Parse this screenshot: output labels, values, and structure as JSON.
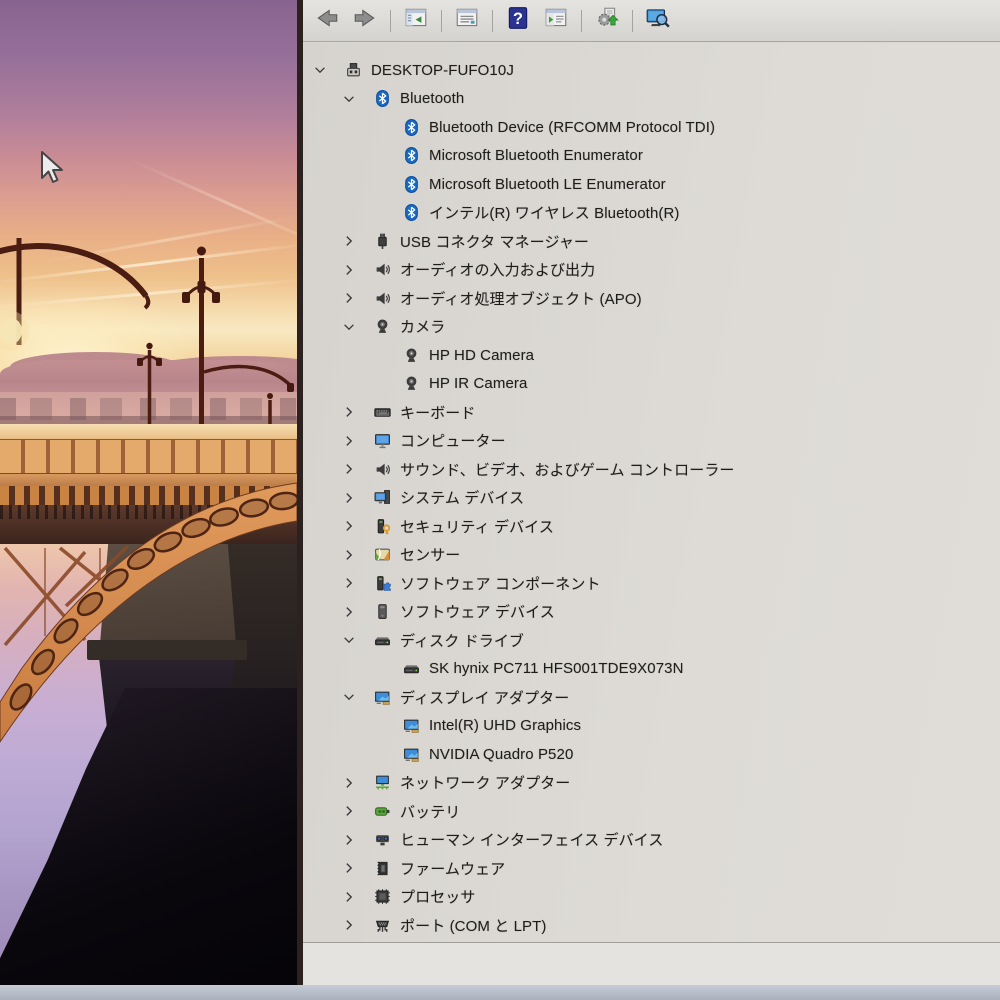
{
  "device_manager": {
    "toolbar": [
      "back",
      "forward",
      "separator",
      "show-console-tree",
      "separator",
      "properties",
      "separator",
      "help",
      "show-action-pane",
      "separator",
      "update-driver",
      "separator",
      "scan-for-hardware-changes"
    ],
    "tree": [
      {
        "label": "DESKTOP-FUFO10J",
        "icon": "computer",
        "level": 0,
        "state": "expanded"
      },
      {
        "label": "Bluetooth",
        "icon": "bluetooth",
        "level": 1,
        "state": "expanded"
      },
      {
        "label": "Bluetooth Device (RFCOMM Protocol TDI)",
        "icon": "bluetooth",
        "level": 2,
        "state": "leaf"
      },
      {
        "label": "Microsoft Bluetooth Enumerator",
        "icon": "bluetooth",
        "level": 2,
        "state": "leaf"
      },
      {
        "label": "Microsoft Bluetooth LE Enumerator",
        "icon": "bluetooth",
        "level": 2,
        "state": "leaf"
      },
      {
        "label": "インテル(R) ワイヤレス Bluetooth(R)",
        "icon": "bluetooth",
        "level": 2,
        "state": "leaf"
      },
      {
        "label": "USB コネクタ マネージャー",
        "icon": "usb",
        "level": 1,
        "state": "collapsed"
      },
      {
        "label": "オーディオの入力および出力",
        "icon": "speaker",
        "level": 1,
        "state": "collapsed"
      },
      {
        "label": "オーディオ処理オブジェクト (APO)",
        "icon": "speaker",
        "level": 1,
        "state": "collapsed"
      },
      {
        "label": "カメラ",
        "icon": "camera",
        "level": 1,
        "state": "expanded"
      },
      {
        "label": "HP HD Camera",
        "icon": "camera",
        "level": 2,
        "state": "leaf"
      },
      {
        "label": "HP IR Camera",
        "icon": "camera",
        "level": 2,
        "state": "leaf"
      },
      {
        "label": "キーボード",
        "icon": "keyboard",
        "level": 1,
        "state": "collapsed"
      },
      {
        "label": "コンピューター",
        "icon": "monitor",
        "level": 1,
        "state": "collapsed"
      },
      {
        "label": "サウンド、ビデオ、およびゲーム コントローラー",
        "icon": "speaker",
        "level": 1,
        "state": "collapsed"
      },
      {
        "label": "システム デバイス",
        "icon": "system-device",
        "level": 1,
        "state": "collapsed"
      },
      {
        "label": "セキュリティ デバイス",
        "icon": "security-device",
        "level": 1,
        "state": "collapsed"
      },
      {
        "label": "センサー",
        "icon": "sensor",
        "level": 1,
        "state": "collapsed"
      },
      {
        "label": "ソフトウェア コンポーネント",
        "icon": "software-component",
        "level": 1,
        "state": "collapsed"
      },
      {
        "label": "ソフトウェア デバイス",
        "icon": "software-device",
        "level": 1,
        "state": "collapsed"
      },
      {
        "label": "ディスク ドライブ",
        "icon": "disk-drive",
        "level": 1,
        "state": "expanded"
      },
      {
        "label": "SK hynix PC711 HFS001TDE9X073N",
        "icon": "disk-drive",
        "level": 2,
        "state": "leaf"
      },
      {
        "label": "ディスプレイ アダプター",
        "icon": "display-adapter",
        "level": 1,
        "state": "expanded"
      },
      {
        "label": "Intel(R) UHD Graphics",
        "icon": "display-adapter",
        "level": 2,
        "state": "leaf"
      },
      {
        "label": "NVIDIA Quadro P520",
        "icon": "display-adapter",
        "level": 2,
        "state": "leaf"
      },
      {
        "label": "ネットワーク アダプター",
        "icon": "network-adapter",
        "level": 1,
        "state": "collapsed"
      },
      {
        "label": "バッテリ",
        "icon": "battery",
        "level": 1,
        "state": "collapsed"
      },
      {
        "label": "ヒューマン インターフェイス デバイス",
        "icon": "hid",
        "level": 1,
        "state": "collapsed"
      },
      {
        "label": "ファームウェア",
        "icon": "firmware",
        "level": 1,
        "state": "collapsed"
      },
      {
        "label": "プロセッサ",
        "icon": "processor",
        "level": 1,
        "state": "collapsed"
      },
      {
        "label": "ポート (COM と LPT)",
        "icon": "port",
        "level": 1,
        "state": "collapsed"
      }
    ]
  },
  "desktop": {
    "cursor": "arrow-pointer"
  },
  "colors": {
    "bluetooth_blue": "#1a6ac4",
    "help_blue": "#2b3390",
    "monitor_blue": "#3e8ddb",
    "battery_green": "#5aa53c",
    "security_key_orange": "#dc9a26",
    "window_background": "#dad7d2",
    "arch_orange": "#d98c4c"
  }
}
